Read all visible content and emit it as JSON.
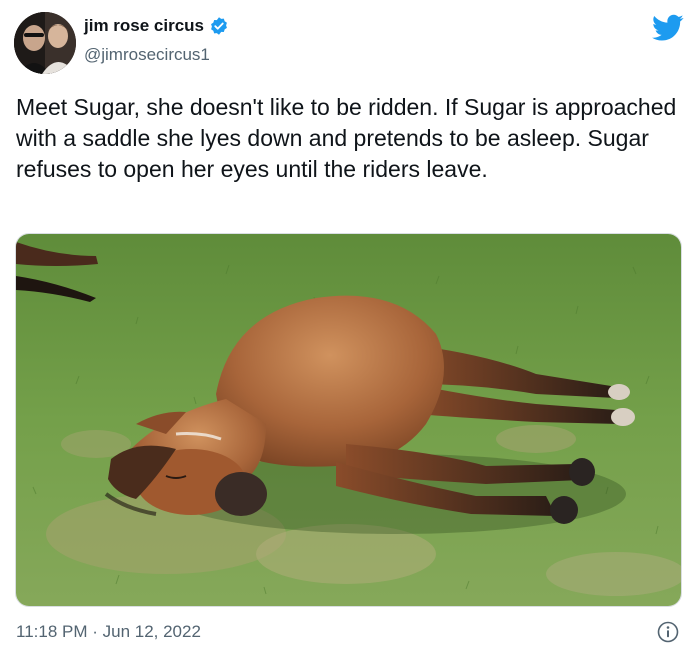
{
  "tweet": {
    "display_name": "jim rose circus",
    "handle": "@jimrosecircus1",
    "text": "Meet Sugar, she doesn't like to be ridden. If Sugar is approached with a saddle she lyes down and pretends to be asleep. Sugar refuses to open her eyes until the riders leave.",
    "timestamp": "11:18 PM · Jun 12, 2022"
  },
  "icons": {
    "verified": "verified-badge-icon",
    "logo": "twitter-bird-icon",
    "info": "info-icon"
  },
  "colors": {
    "brand_blue": "#1d9bf0",
    "text_primary": "#0f1419",
    "text_secondary": "#536471",
    "grass": "#6f9a45",
    "horse_coat": "#a8653a"
  }
}
